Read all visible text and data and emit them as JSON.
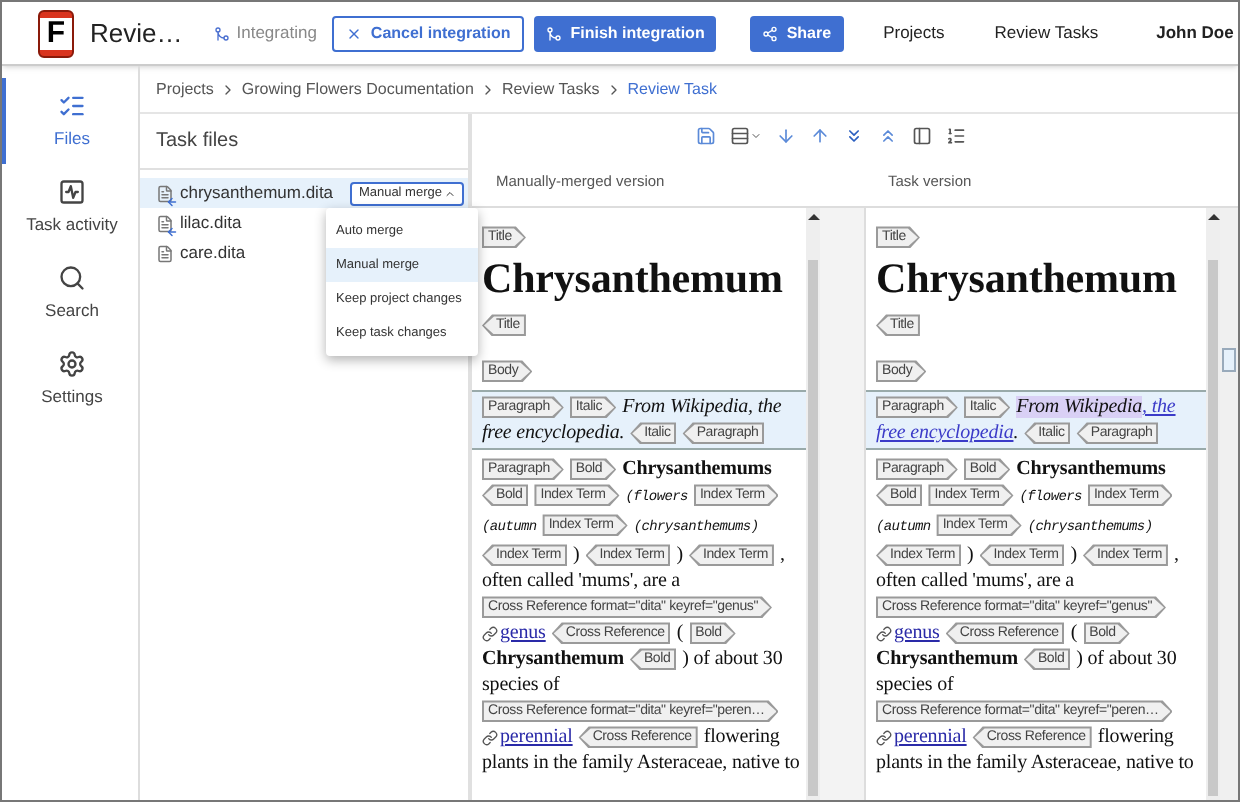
{
  "header": {
    "logo": "F",
    "title": "Revie…",
    "status": "Integrating",
    "buttons": [
      {
        "label": "Cancel integration",
        "kind": "outline"
      },
      {
        "label": "Finish integration",
        "kind": "filled"
      },
      {
        "label": "Share",
        "kind": "filled"
      }
    ],
    "links": [
      "Projects",
      "Review Tasks"
    ],
    "user": "John Doe"
  },
  "nav": [
    {
      "label": "Files",
      "selected": true
    },
    {
      "label": "Task activity",
      "selected": false
    },
    {
      "label": "Search",
      "selected": false
    },
    {
      "label": "Settings",
      "selected": false
    }
  ],
  "breadcrumb": [
    {
      "label": "Projects",
      "selected": false
    },
    {
      "label": "Growing Flowers Documentation",
      "selected": false
    },
    {
      "label": "Review Tasks",
      "selected": false
    },
    {
      "label": "Review Task",
      "selected": true
    }
  ],
  "task_files": {
    "title": "Task files",
    "files": [
      {
        "name": "chrysanthemum.dita",
        "selected": true,
        "changed": true,
        "merge_button": {
          "label": "Manual merge",
          "expanded": true
        }
      },
      {
        "name": "lilac.dita",
        "selected": false,
        "changed": true
      },
      {
        "name": "care.dita",
        "selected": false,
        "changed": false
      }
    ],
    "merge_menu": [
      {
        "label": "Auto merge",
        "selected": false
      },
      {
        "label": "Manual merge",
        "selected": true
      },
      {
        "label": "Keep project changes",
        "selected": false
      },
      {
        "label": "Keep task changes",
        "selected": false
      }
    ]
  },
  "panes": [
    {
      "label": "Manually-merged version",
      "blocks": [
        {
          "kind": "line",
          "highlighted": false,
          "items": [
            {
              "kind": "open",
              "text": "Title"
            }
          ]
        },
        {
          "kind": "heading",
          "highlighted": false,
          "text": "Chrysanthemum"
        },
        {
          "kind": "line",
          "highlighted": false,
          "items": [
            {
              "kind": "close",
              "text": "Title"
            }
          ]
        },
        {
          "kind": "line",
          "highlighted": false,
          "items": [
            {
              "kind": "open",
              "text": "Body"
            }
          ]
        },
        {
          "kind": "line",
          "highlighted": true,
          "items": [
            {
              "kind": "open",
              "text": "Paragraph"
            },
            {
              "kind": "open",
              "text": "Italic"
            },
            {
              "kind": "italic",
              "text": "From Wikipedia, the"
            },
            {
              "kind": "italic",
              "text": "free encyclopedia."
            },
            {
              "kind": "close",
              "text": "Italic"
            },
            {
              "kind": "close",
              "text": "Paragraph"
            }
          ]
        },
        {
          "kind": "line",
          "highlighted": false,
          "items": [
            {
              "kind": "open",
              "text": "Paragraph"
            },
            {
              "kind": "open",
              "text": "Bold"
            },
            {
              "kind": "bold",
              "text": "Chrysanthemums"
            },
            {
              "kind": "close",
              "text": "Bold"
            },
            {
              "kind": "open",
              "text": "Index Term"
            },
            {
              "kind": "mono",
              "text": "(flowers"
            },
            {
              "kind": "open",
              "text": "Index Term"
            },
            {
              "kind": "mono",
              "text": "(autumn"
            },
            {
              "kind": "open",
              "text": "Index Term"
            },
            {
              "kind": "mono",
              "text": "(chrysanthemums)"
            },
            {
              "kind": "close",
              "text": "Index Term"
            },
            {
              "kind": "text",
              "text": ")"
            },
            {
              "kind": "close",
              "text": "Index Term"
            },
            {
              "kind": "text",
              "text": ")"
            },
            {
              "kind": "close",
              "text": "Index Term"
            },
            {
              "kind": "text",
              "text": ","
            },
            {
              "kind": "text",
              "text": "often called 'mums', are a"
            },
            {
              "kind": "open",
              "text": "Cross Reference format=\"dita\" keyref=\"genus\""
            },
            {
              "kind": "link",
              "text": "genus"
            },
            {
              "kind": "close",
              "text": "Cross Reference"
            },
            {
              "kind": "text",
              "text": "("
            },
            {
              "kind": "open",
              "text": "Bold"
            },
            {
              "kind": "bold",
              "text": "Chrysanthemum"
            },
            {
              "kind": "close",
              "text": "Bold"
            },
            {
              "kind": "text",
              "text": ") of about 30"
            },
            {
              "kind": "text",
              "text": "species of"
            },
            {
              "kind": "open",
              "text": "Cross Reference format=\"dita\" keyref=\"peren…"
            },
            {
              "kind": "link",
              "text": "perennial"
            },
            {
              "kind": "close",
              "text": "Cross Reference"
            },
            {
              "kind": "text",
              "text": "flowering"
            },
            {
              "kind": "text",
              "text": "plants in the family Asteraceae, native to"
            }
          ]
        }
      ]
    },
    {
      "label": "Task version",
      "blocks": [
        {
          "kind": "line",
          "highlighted": false,
          "items": [
            {
              "kind": "open",
              "text": "Title"
            }
          ]
        },
        {
          "kind": "heading",
          "highlighted": false,
          "text": "Chrysanthemum"
        },
        {
          "kind": "line",
          "highlighted": false,
          "items": [
            {
              "kind": "close",
              "text": "Title"
            }
          ]
        },
        {
          "kind": "line",
          "highlighted": false,
          "items": [
            {
              "kind": "open",
              "text": "Body"
            }
          ]
        },
        {
          "kind": "line",
          "highlighted": true,
          "items": [
            {
              "kind": "open",
              "text": "Paragraph"
            },
            {
              "kind": "open",
              "text": "Italic"
            },
            {
              "kind": "changed",
              "text": "From Wikipedia"
            },
            {
              "kind": "italic-link",
              "text": ", the"
            },
            {
              "kind": "italic-link",
              "text": "free encyclopedia"
            },
            {
              "kind": "punctuation",
              "text": "."
            },
            {
              "kind": "close",
              "text": "Italic"
            },
            {
              "kind": "close",
              "text": "Paragraph"
            }
          ]
        },
        {
          "kind": "line",
          "highlighted": false,
          "items": [
            {
              "kind": "open",
              "text": "Paragraph"
            },
            {
              "kind": "open",
              "text": "Bold"
            },
            {
              "kind": "bold",
              "text": "Chrysanthemums"
            },
            {
              "kind": "close",
              "text": "Bold"
            },
            {
              "kind": "open",
              "text": "Index Term"
            },
            {
              "kind": "mono",
              "text": "(flowers"
            },
            {
              "kind": "open",
              "text": "Index Term"
            },
            {
              "kind": "mono",
              "text": "(autumn"
            },
            {
              "kind": "open",
              "text": "Index Term"
            },
            {
              "kind": "mono",
              "text": "(chrysanthemums)"
            },
            {
              "kind": "close",
              "text": "Index Term"
            },
            {
              "kind": "text",
              "text": ")"
            },
            {
              "kind": "close",
              "text": "Index Term"
            },
            {
              "kind": "text",
              "text": ")"
            },
            {
              "kind": "close",
              "text": "Index Term"
            },
            {
              "kind": "text",
              "text": ","
            },
            {
              "kind": "text",
              "text": "often called 'mums', are a"
            },
            {
              "kind": "open",
              "text": "Cross Reference format=\"dita\" keyref=\"genus\""
            },
            {
              "kind": "link",
              "text": "genus"
            },
            {
              "kind": "close",
              "text": "Cross Reference"
            },
            {
              "kind": "text",
              "text": "("
            },
            {
              "kind": "open",
              "text": "Bold"
            },
            {
              "kind": "bold",
              "text": "Chrysanthemum"
            },
            {
              "kind": "close",
              "text": "Bold"
            },
            {
              "kind": "text",
              "text": ") of about 30"
            },
            {
              "kind": "text",
              "text": "species of"
            },
            {
              "kind": "open",
              "text": "Cross Reference format=\"dita\" keyref=\"peren…"
            },
            {
              "kind": "link",
              "text": "perennial"
            },
            {
              "kind": "close",
              "text": "Cross Reference"
            },
            {
              "kind": "text",
              "text": "flowering"
            },
            {
              "kind": "text",
              "text": "plants in the family Asteraceae, native to"
            }
          ]
        }
      ]
    }
  ]
}
